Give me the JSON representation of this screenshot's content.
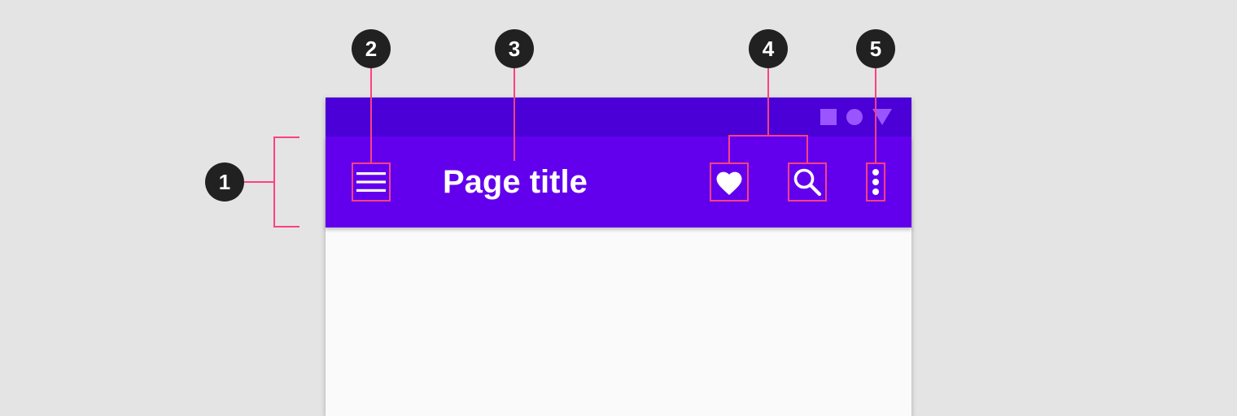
{
  "app_bar": {
    "title": "Page title",
    "background_color": "#6200ee",
    "status_bar_color": "#4a00d6",
    "navigation_icon": "menu-icon",
    "action_icons": [
      "heart-icon",
      "search-icon"
    ],
    "overflow_icon": "more-vert-icon",
    "status_icons": [
      "square-icon",
      "circle-icon",
      "triangle-icon"
    ]
  },
  "callouts": [
    "1",
    "2",
    "3",
    "4",
    "5"
  ],
  "annotation_color": "#ff4081",
  "callout_color": "#212121"
}
